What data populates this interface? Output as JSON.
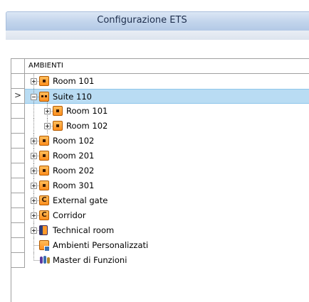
{
  "window": {
    "title": "Configurazione ETS"
  },
  "grid": {
    "header": "AMBIENTI",
    "rows": [
      {
        "label": "Room 101",
        "icon": "room-icon",
        "level": 0,
        "expander": "plus",
        "selected": false
      },
      {
        "label": "Suite 110",
        "icon": "suite-icon",
        "level": 0,
        "expander": "minus",
        "selected": true
      },
      {
        "label": "Room 101",
        "icon": "room-icon",
        "level": 1,
        "expander": "plus",
        "selected": false
      },
      {
        "label": "Room 102",
        "icon": "room-icon",
        "level": 1,
        "expander": "plus",
        "selected": false
      },
      {
        "label": "Room 102",
        "icon": "room-icon",
        "level": 0,
        "expander": "plus",
        "selected": false
      },
      {
        "label": "Room 201",
        "icon": "room-icon",
        "level": 0,
        "expander": "plus",
        "selected": false
      },
      {
        "label": "Room 202",
        "icon": "room-icon",
        "level": 0,
        "expander": "plus",
        "selected": false
      },
      {
        "label": "Room 301",
        "icon": "room-icon",
        "level": 0,
        "expander": "plus",
        "selected": false
      },
      {
        "label": "External gate",
        "icon": "common-area-icon",
        "level": 0,
        "expander": "plus",
        "selected": false
      },
      {
        "label": "Corridor",
        "icon": "common-area-icon",
        "level": 0,
        "expander": "plus",
        "selected": false
      },
      {
        "label": "Technical room",
        "icon": "technical-room-icon",
        "level": 0,
        "expander": "plus",
        "selected": false
      },
      {
        "label": "Ambienti Personalizzati",
        "icon": "custom-environments-icon",
        "level": 0,
        "expander": "none",
        "selected": false
      },
      {
        "label": "Master di Funzioni",
        "icon": "function-master-icon",
        "level": 0,
        "expander": "none",
        "selected": false
      }
    ]
  },
  "colors": {
    "selection": "#b9dcf3",
    "room_icon": "#ff9a2a",
    "grid_line": "#a0a0a0"
  }
}
